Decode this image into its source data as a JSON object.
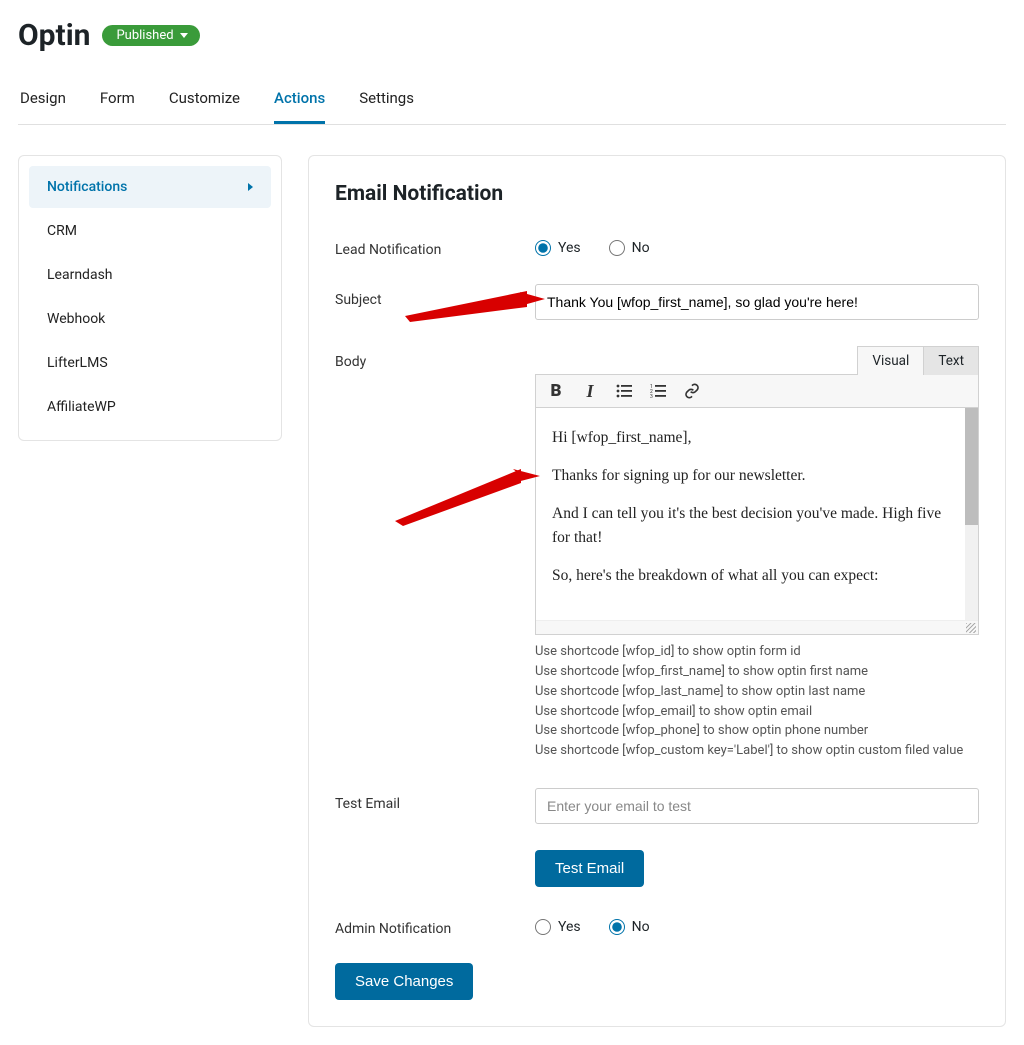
{
  "header": {
    "title": "Optin",
    "badge": "Published"
  },
  "tabs": [
    "Design",
    "Form",
    "Customize",
    "Actions",
    "Settings"
  ],
  "active_tab": "Actions",
  "sidebar": {
    "items": [
      "Notifications",
      "CRM",
      "Learndash",
      "Webhook",
      "LifterLMS",
      "AffiliateWP"
    ],
    "active": "Notifications"
  },
  "section_title": "Email Notification",
  "lead_notif": {
    "label": "Lead Notification",
    "yes": "Yes",
    "no": "No"
  },
  "subject": {
    "label": "Subject",
    "value": "Thank You [wfop_first_name], so glad you're here!"
  },
  "body": {
    "label": "Body",
    "tab_visual": "Visual",
    "tab_text": "Text",
    "p1": "Hi [wfop_first_name],",
    "p2": "Thanks for signing up for our newsletter.",
    "p3": "And I can tell you it's the best decision you've made. High five for that!",
    "p4": "So, here's the breakdown of what all you can expect:"
  },
  "hints": {
    "h1": "Use shortcode [wfop_id] to show optin form id",
    "h2": "Use shortcode [wfop_first_name] to show optin first name",
    "h3": "Use shortcode [wfop_last_name] to show optin last name",
    "h4": "Use shortcode [wfop_email] to show optin email",
    "h5": "Use shortcode [wfop_phone] to show optin phone number",
    "h6": "Use shortcode [wfop_custom key='Label'] to show optin custom filed value"
  },
  "test_email": {
    "label": "Test Email",
    "placeholder": "Enter your email to test",
    "button": "Test Email"
  },
  "admin_notif": {
    "label": "Admin Notification",
    "yes": "Yes",
    "no": "No"
  },
  "save": "Save Changes"
}
